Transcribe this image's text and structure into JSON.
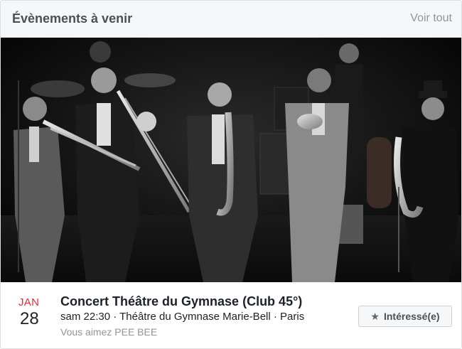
{
  "header": {
    "title": "Évènements à venir",
    "see_all": "Voir tout"
  },
  "event": {
    "month": "JAN",
    "day": "28",
    "title": "Concert Théâtre du Gymnase (Club 45°)",
    "datetime": "sam 22:30",
    "separator": " · ",
    "venue": "Théâtre du Gymnase Marie-Bell",
    "city": "Paris",
    "social_context": "Vous aimez PEE BEE",
    "interested_label": "Intéressé(e)",
    "interested_icon": "star-icon"
  },
  "photo": {
    "subject": "concert-photo",
    "style": "black-and-white"
  },
  "colors": {
    "month_red": "#e02d3a",
    "header_bg": "#f6f7f9",
    "muted_text": "#90949c"
  }
}
